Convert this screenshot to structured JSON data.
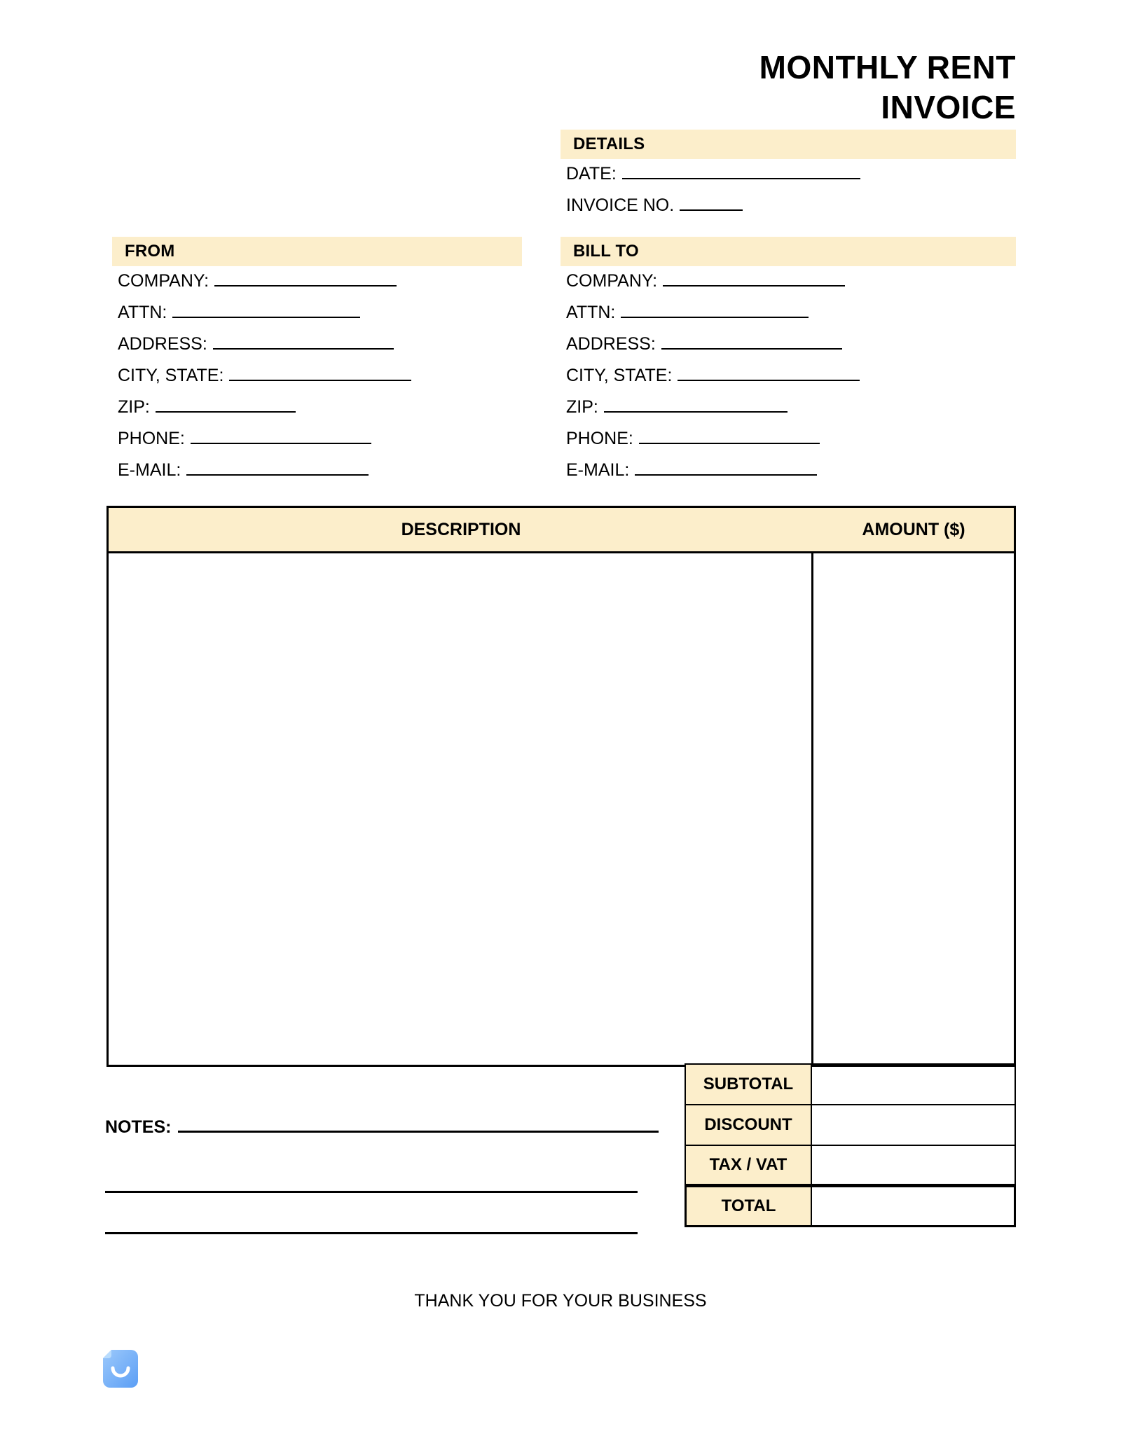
{
  "document": {
    "title_line_1": "MONTHLY RENT",
    "title_line_2": "INVOICE"
  },
  "details": {
    "header": "DETAILS",
    "fields": [
      {
        "label": "DATE:",
        "value": "",
        "rule_width": 340
      },
      {
        "label": "INVOICE NO.",
        "value": "",
        "rule_width": 90
      }
    ]
  },
  "from": {
    "header": "FROM",
    "fields": [
      {
        "label": "COMPANY:",
        "value": "",
        "rule_width": 260
      },
      {
        "label": "ATTN:",
        "value": "",
        "rule_width": 268
      },
      {
        "label": "ADDRESS:",
        "value": "",
        "rule_width": 258
      },
      {
        "label": "CITY, STATE:",
        "value": "",
        "rule_width": 260
      },
      {
        "label": "ZIP:",
        "value": "",
        "rule_width": 200
      },
      {
        "label": "PHONE:",
        "value": "",
        "rule_width": 258
      },
      {
        "label": "E-MAIL:",
        "value": "",
        "rule_width": 260
      }
    ]
  },
  "bill_to": {
    "header": "BILL TO",
    "fields": [
      {
        "label": "COMPANY:",
        "value": "",
        "rule_width": 260
      },
      {
        "label": "ATTN:",
        "value": "",
        "rule_width": 268
      },
      {
        "label": "ADDRESS:",
        "value": "",
        "rule_width": 258
      },
      {
        "label": "CITY, STATE:",
        "value": "",
        "rule_width": 260
      },
      {
        "label": "ZIP:",
        "value": "",
        "rule_width": 262
      },
      {
        "label": "PHONE:",
        "value": "",
        "rule_width": 258
      },
      {
        "label": "E-MAIL:",
        "value": "",
        "rule_width": 260
      }
    ]
  },
  "items_table": {
    "columns": [
      {
        "header": "DESCRIPTION"
      },
      {
        "header": "AMOUNT ($)"
      }
    ],
    "rows": []
  },
  "totals": {
    "rows": [
      {
        "label": "SUBTOTAL",
        "value": ""
      },
      {
        "label": "DISCOUNT",
        "value": ""
      },
      {
        "label": "TAX / VAT",
        "value": ""
      }
    ],
    "total": {
      "label": "TOTAL",
      "value": ""
    }
  },
  "notes": {
    "label": "NOTES:",
    "lines": [
      "",
      "",
      ""
    ]
  },
  "footer": {
    "thanks": "THANK YOU FOR YOUR BUSINESS",
    "logo_icon": "document-smile-icon"
  },
  "colors": {
    "cream_band": "#fceecb",
    "ink": "#000000",
    "logo_blue_light": "#8ec5fb",
    "logo_blue_dark": "#5b9ef5"
  }
}
